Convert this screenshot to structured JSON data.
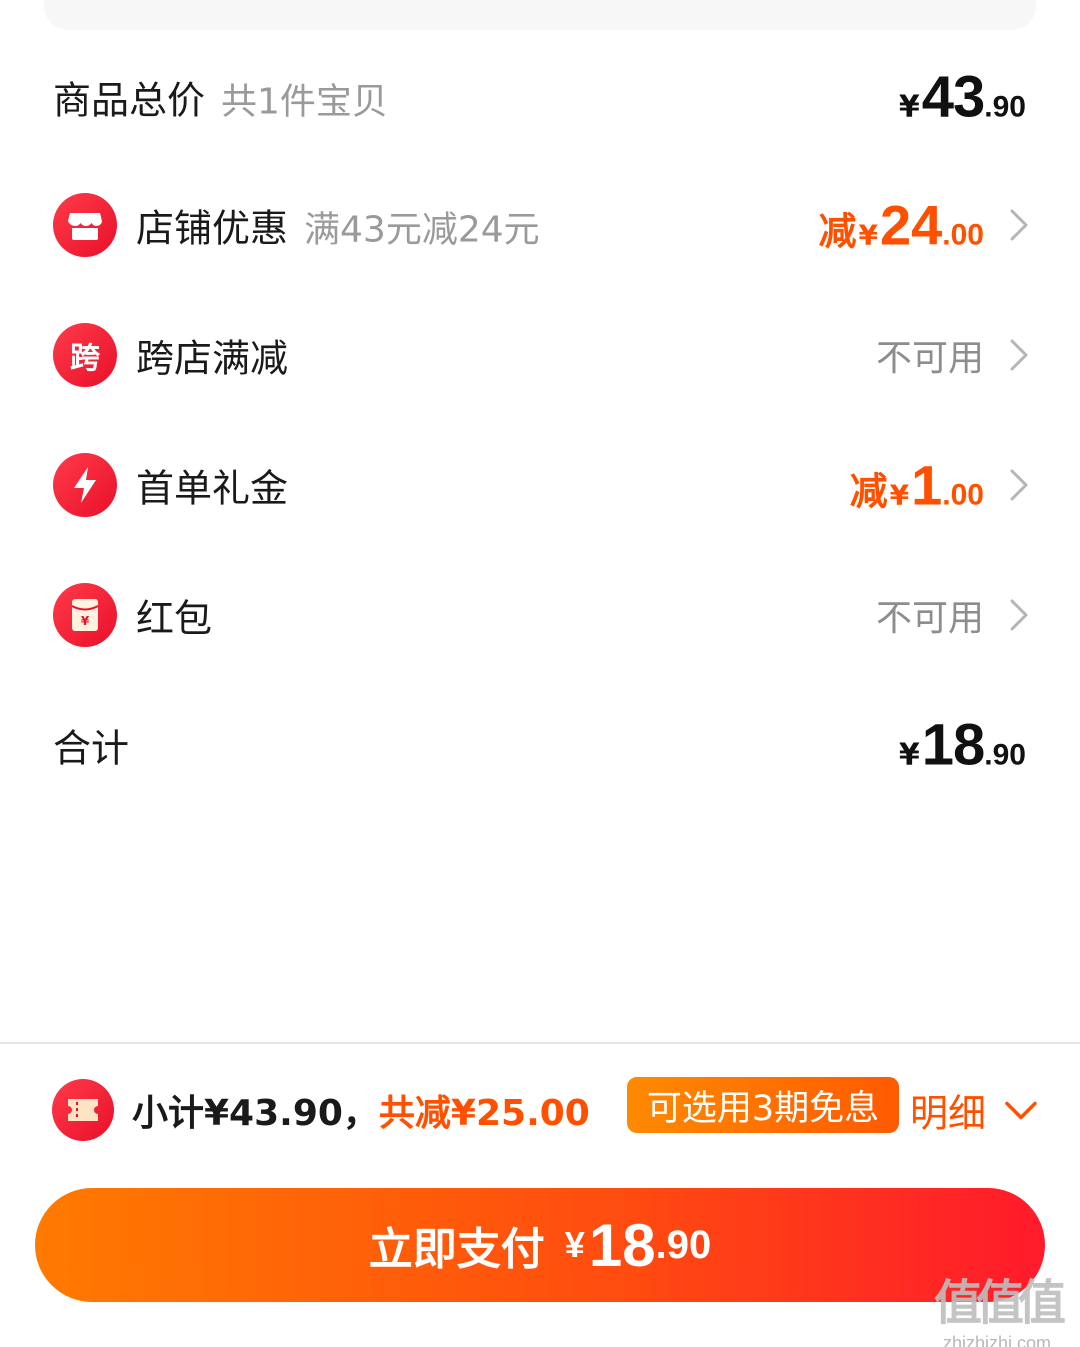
{
  "order_summary": {
    "total_price": {
      "label": "商品总价",
      "count_text": "共1件宝贝",
      "yen": "¥",
      "int": "43",
      "dec": ".90"
    },
    "shop_discount": {
      "label": "店铺优惠",
      "detail": "满43元减24元",
      "minus": "减",
      "yen": "¥",
      "int": "24",
      "dec": ".00"
    },
    "cross_store": {
      "icon_char": "跨",
      "label": "跨店满减",
      "value": "不可用"
    },
    "first_order_gift": {
      "label": "首单礼金",
      "minus": "减",
      "yen": "¥",
      "int": "1",
      "dec": ".00"
    },
    "red_packet": {
      "label": "红包",
      "value": "不可用",
      "icon_char": "¥"
    },
    "sum": {
      "label": "合计",
      "yen": "¥",
      "int": "18",
      "dec": ".90"
    }
  },
  "footer": {
    "subtotal_text": "小计¥43.90，",
    "saved_text": "共减¥25.00",
    "installment_badge": "可选用3期免息",
    "detail_label": "明细",
    "pay_button": {
      "label": "立即支付",
      "yen": "¥",
      "int": "18",
      "dec": ".90"
    }
  },
  "watermark": {
    "logo": "值值值",
    "url": "zhizhizhi.com"
  },
  "colors": {
    "accent_orange": "#ff5000",
    "accent_red": "#ff1a2c",
    "icon_red": "#e8102a"
  },
  "icons": [
    "store-icon",
    "cross-store-char-icon",
    "lightning-icon",
    "red-packet-icon",
    "ticket-icon",
    "chevron-right-icon",
    "chevron-down-icon"
  ]
}
